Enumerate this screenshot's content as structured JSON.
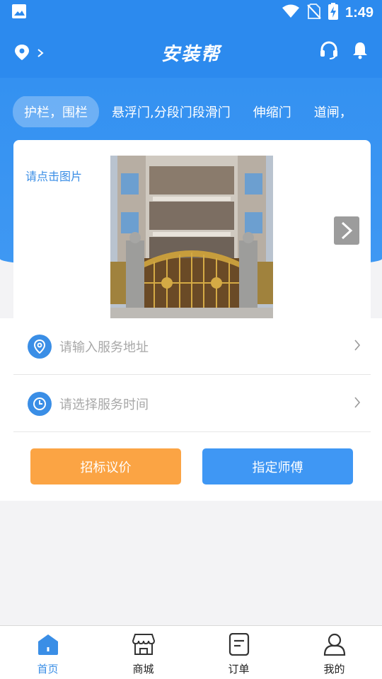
{
  "status_bar": {
    "time": "1:49"
  },
  "app_bar": {
    "title": "安装帮"
  },
  "tabs": [
    {
      "label": "护栏，围栏",
      "active": true
    },
    {
      "label": "悬浮门,分段门段滑门",
      "active": false
    },
    {
      "label": "伸缩门",
      "active": false
    },
    {
      "label": "道闸，",
      "active": false
    }
  ],
  "card": {
    "hint": "请点击图片"
  },
  "form": {
    "address_placeholder": "请输入服务地址",
    "time_placeholder": "请选择服务时间"
  },
  "buttons": {
    "bid": "招标议价",
    "assign": "指定师傅"
  },
  "bottom_nav": [
    {
      "label": "首页",
      "icon": "home-icon",
      "active": true
    },
    {
      "label": "商城",
      "icon": "shop-icon",
      "active": false
    },
    {
      "label": "订单",
      "icon": "order-icon",
      "active": false
    },
    {
      "label": "我的",
      "icon": "user-icon",
      "active": false
    }
  ],
  "colors": {
    "primary": "#2c8aee",
    "orange": "#fba444",
    "blue_button": "#3f97f4"
  }
}
